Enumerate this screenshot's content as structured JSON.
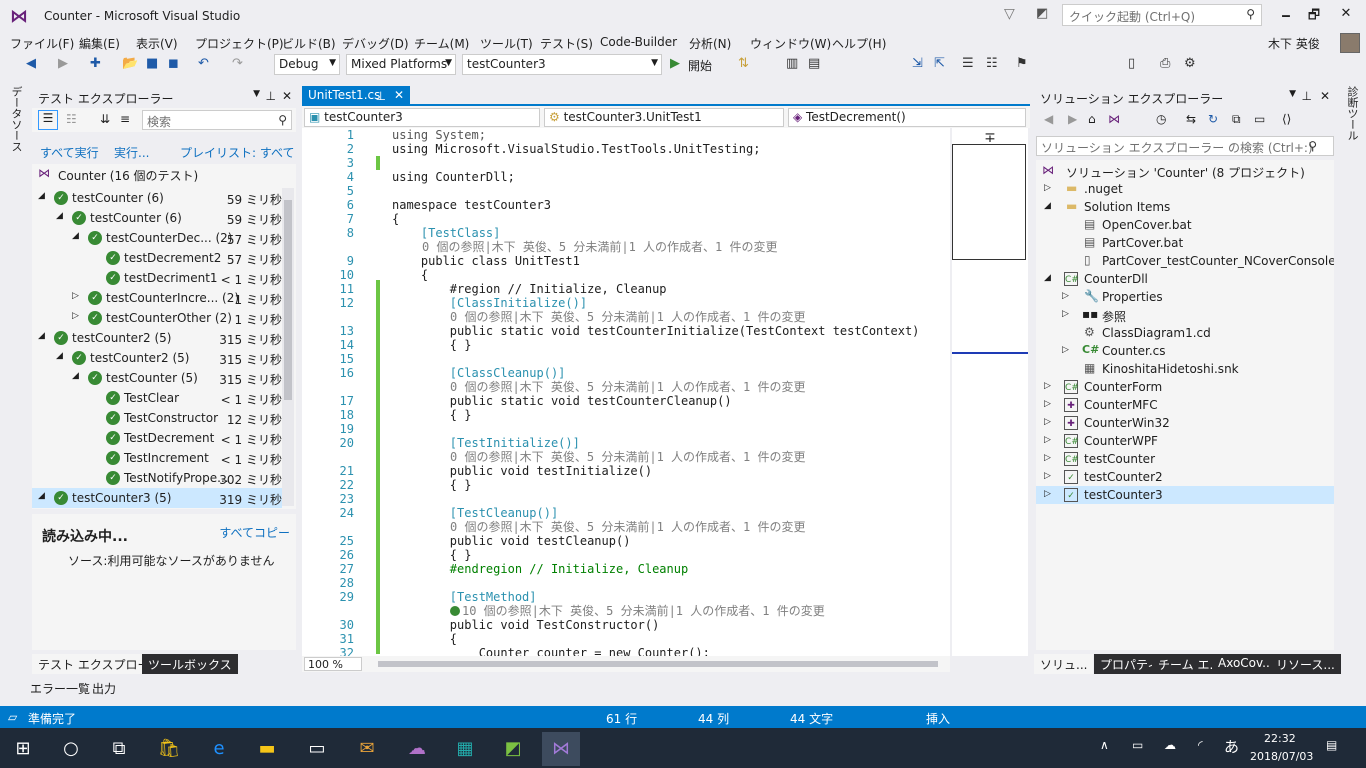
{
  "window": {
    "title": "Counter - Microsoft Visual Studio",
    "quick_launch_placeholder": "クイック起動 (Ctrl+Q)",
    "minimize": "🗕",
    "maximize": "🗗",
    "close": "✕"
  },
  "menu": [
    "ファイル(F)",
    "編集(E)",
    "表示(V)",
    "プロジェクト(P)",
    "ビルド(B)",
    "デバッグ(D)",
    "チーム(M)",
    "ツール(T)",
    "テスト(S)",
    "Code-Builder",
    "分析(N)",
    "ウィンドウ(W)",
    "ヘルプ(H)"
  ],
  "user": {
    "name": "木下 英俊"
  },
  "toolbar": {
    "config": "Debug",
    "platform": "Mixed Platforms",
    "startup": "testCounter3",
    "start_label": "開始"
  },
  "left_strip": {
    "label": "データソース"
  },
  "right_strip": {
    "label": "診断ツール"
  },
  "test_explorer": {
    "title": "テスト エクスプローラー",
    "search_placeholder": "検索",
    "run_all": "すべて実行",
    "run": "実行...",
    "playlist": "プレイリスト: すべてのテス",
    "root": "Counter (16 個のテスト)",
    "rows": [
      {
        "label": "testCounter (6)",
        "dur": "59 ミリ秒"
      },
      {
        "label": "testCounter (6)",
        "dur": "59 ミリ秒"
      },
      {
        "label": "testCounterDec... (2)",
        "dur": "57 ミリ秒"
      },
      {
        "label": "testDecrement2",
        "dur": "57 ミリ秒"
      },
      {
        "label": "testDecriment1",
        "dur": "< 1 ミリ秒"
      },
      {
        "label": "testCounterIncre... (2)",
        "dur": "1 ミリ秒"
      },
      {
        "label": "testCounterOther (2)",
        "dur": "1 ミリ秒"
      },
      {
        "label": "testCounter2 (5)",
        "dur": "315 ミリ秒"
      },
      {
        "label": "testCounter2 (5)",
        "dur": "315 ミリ秒"
      },
      {
        "label": "testCounter (5)",
        "dur": "315 ミリ秒"
      },
      {
        "label": "TestClear",
        "dur": "< 1 ミリ秒"
      },
      {
        "label": "TestConstructor",
        "dur": "12 ミリ秒"
      },
      {
        "label": "TestDecrement",
        "dur": "< 1 ミリ秒"
      },
      {
        "label": "TestIncrement",
        "dur": "< 1 ミリ秒"
      },
      {
        "label": "TestNotifyPrope...",
        "dur": "302 ミリ秒"
      },
      {
        "label": "testCounter3 (5)",
        "dur": "319 ミリ秒"
      }
    ],
    "detail_title": "読み込み中...",
    "copy_all": "すべてコピー",
    "detail_source": "ソース:利用可能なソースがありません",
    "tab_test_explorer": "テスト エクスプローラー",
    "tab_toolbox": "ツールボックス"
  },
  "editor": {
    "tab": "UnitTest1.cs",
    "nav_project": "testCounter3",
    "nav_class": "testCounter3.UnitTest1",
    "nav_member": "TestDecrement()",
    "zoom": "100 %",
    "lens": "0 個の参照|木下 英俊、5 分未満前|1 人の作成者、1 件の変更",
    "lens10": "10 個の参照|木下 英俊、5 分未満前|1 人の作成者、1 件の変更",
    "lines": [
      {
        "n": "1",
        "t": "using System;"
      },
      {
        "n": "2",
        "t": "using Microsoft.VisualStudio.TestTools.UnitTesting;"
      },
      {
        "n": "3",
        "t": ""
      },
      {
        "n": "4",
        "t": "using CounterDll;"
      },
      {
        "n": "5",
        "t": ""
      },
      {
        "n": "6",
        "t": "namespace testCounter3"
      },
      {
        "n": "7",
        "t": "{"
      },
      {
        "n": "8",
        "t": "    [TestClass]"
      },
      {
        "n": "9",
        "t": "    public class UnitTest1"
      },
      {
        "n": "10",
        "t": "    {"
      },
      {
        "n": "11",
        "t": "        #region // Initialize, Cleanup"
      },
      {
        "n": "12",
        "t": "        [ClassInitialize()]"
      },
      {
        "n": "13",
        "t": "        public static void testCounterInitialize(TestContext testContext)"
      },
      {
        "n": "14",
        "t": "        { }"
      },
      {
        "n": "15",
        "t": ""
      },
      {
        "n": "16",
        "t": "        [ClassCleanup()]"
      },
      {
        "n": "17",
        "t": "        public static void testCounterCleanup()"
      },
      {
        "n": "18",
        "t": "        { }"
      },
      {
        "n": "19",
        "t": ""
      },
      {
        "n": "20",
        "t": "        [TestInitialize()]"
      },
      {
        "n": "21",
        "t": "        public void testInitialize()"
      },
      {
        "n": "22",
        "t": "        { }"
      },
      {
        "n": "23",
        "t": ""
      },
      {
        "n": "24",
        "t": "        [TestCleanup()]"
      },
      {
        "n": "25",
        "t": "        public void testCleanup()"
      },
      {
        "n": "26",
        "t": "        { }"
      },
      {
        "n": "27",
        "t": "        #endregion // Initialize, Cleanup"
      },
      {
        "n": "28",
        "t": ""
      },
      {
        "n": "29",
        "t": "        [TestMethod]"
      },
      {
        "n": "30",
        "t": "        public void TestConstructor()"
      },
      {
        "n": "31",
        "t": "        {"
      },
      {
        "n": "32",
        "t": "            Counter counter = new Counter();"
      }
    ]
  },
  "solution_explorer": {
    "title": "ソリューション エクスプローラー",
    "search_placeholder": "ソリューション エクスプローラー の検索 (Ctrl+:)",
    "items": [
      "ソリューション 'Counter' (8 プロジェクト)",
      ".nuget",
      "Solution Items",
      "OpenCover.bat",
      "PartCover.bat",
      "PartCover_testCounter_NCoverConsole.xml",
      "CounterDll",
      "Properties",
      "参照",
      "ClassDiagram1.cd",
      "Counter.cs",
      "KinoshitaHidetoshi.snk",
      "CounterForm",
      "CounterMFC",
      "CounterWin32",
      "CounterWPF",
      "testCounter",
      "testCounter2",
      "testCounter3"
    ],
    "tabs": [
      "ソリュ...",
      "プロパティ",
      "チーム エ...",
      "AxoCov...",
      "リソース..."
    ]
  },
  "bottom_tabs": [
    "エラー一覧",
    "出力"
  ],
  "status": {
    "ready": "準備完了",
    "line": "61 行",
    "col": "44 列",
    "ch": "44 文字",
    "mode": "挿入"
  },
  "taskbar": {
    "time": "22:32",
    "date": "2018/07/03",
    "ime": "あ"
  }
}
